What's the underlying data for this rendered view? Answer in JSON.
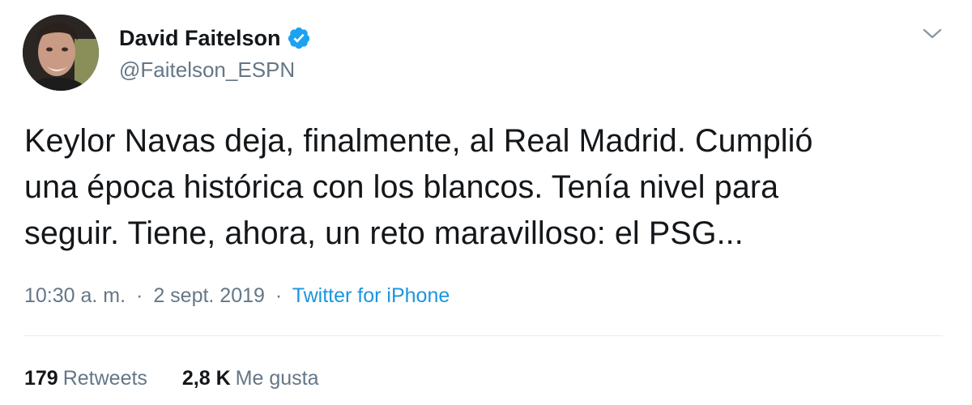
{
  "author": {
    "display_name": "David Faitelson",
    "handle": "@Faitelson_ESPN",
    "verified": true
  },
  "tweet": {
    "lines": [
      "Keylor Navas deja, finalmente, al Real Madrid. Cumplió",
      "una época histórica con los blancos. Tenía nivel para",
      "seguir. Tiene, ahora, un reto maravilloso: el PSG..."
    ]
  },
  "meta": {
    "time": "10:30 a. m.",
    "separator": "·",
    "date": "2 sept. 2019",
    "source": "Twitter for iPhone"
  },
  "stats": {
    "retweets_count": "179",
    "retweets_label": "Retweets",
    "likes_count": "2,8 K",
    "likes_label": "Me gusta"
  },
  "icons": {
    "verified": "verified-badge-icon",
    "menu": "chevron-down-icon"
  },
  "colors": {
    "text_primary": "#14171a",
    "text_secondary": "#657786",
    "link": "#1b95e0",
    "verified": "#1da1f2",
    "divider": "#e6ecf0"
  }
}
